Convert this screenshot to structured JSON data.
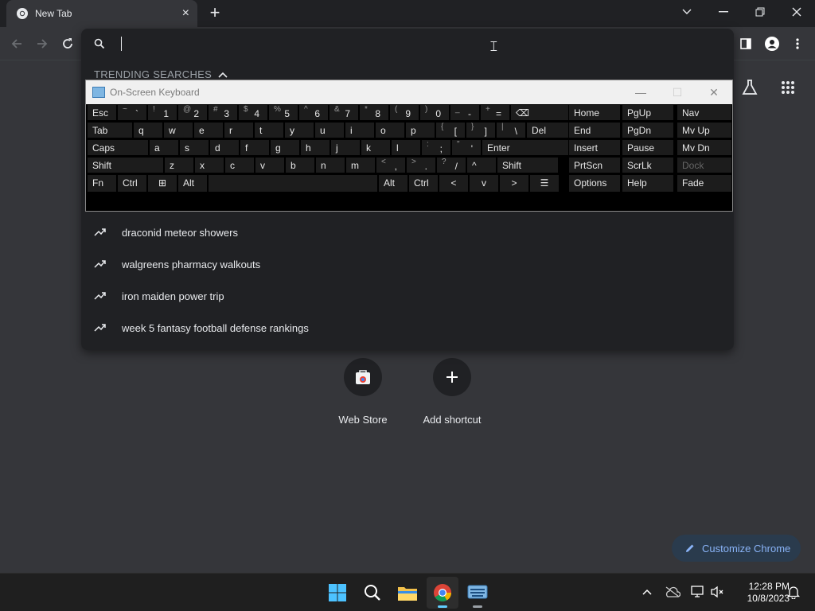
{
  "browser": {
    "tab_title": "New Tab",
    "new_tab_symbol": "+",
    "close_tab_symbol": "×"
  },
  "omnibox": {
    "trending_label": "TRENDING SEARCHES",
    "suggestions": [
      "draconid meteor showers",
      "walgreens pharmacy walkouts",
      "iron maiden power trip",
      "week 5 fantasy football defense rankings"
    ]
  },
  "shortcuts": [
    {
      "label": "Web Store"
    },
    {
      "label": "Add shortcut"
    }
  ],
  "customize_label": "Customize Chrome",
  "osk": {
    "title": "On-Screen Keyboard",
    "rows": [
      {
        "keys": [
          {
            "lbl": "Esc"
          },
          {
            "sub": "~",
            "main": "`"
          },
          {
            "sub": "!",
            "main": "1"
          },
          {
            "sub": "@",
            "main": "2"
          },
          {
            "sub": "#",
            "main": "3"
          },
          {
            "sub": "$",
            "main": "4"
          },
          {
            "sub": "%",
            "main": "5"
          },
          {
            "sub": "^",
            "main": "6"
          },
          {
            "sub": "&",
            "main": "7"
          },
          {
            "sub": "*",
            "main": "8"
          },
          {
            "sub": "(",
            "main": "9"
          },
          {
            "sub": ")",
            "main": "0"
          },
          {
            "sub": "_",
            "main": "-"
          },
          {
            "sub": "+",
            "main": "="
          },
          {
            "lbl": "⌫"
          }
        ]
      },
      {
        "keys": [
          {
            "lbl": "Tab"
          },
          {
            "lbl": "q"
          },
          {
            "lbl": "w"
          },
          {
            "lbl": "e"
          },
          {
            "lbl": "r"
          },
          {
            "lbl": "t"
          },
          {
            "lbl": "y"
          },
          {
            "lbl": "u"
          },
          {
            "lbl": "i"
          },
          {
            "lbl": "o"
          },
          {
            "lbl": "p"
          },
          {
            "sub": "{",
            "main": "["
          },
          {
            "sub": "}",
            "main": "]"
          },
          {
            "sub": "|",
            "main": "\\"
          },
          {
            "lbl": "Del"
          }
        ]
      },
      {
        "keys": [
          {
            "lbl": "Caps"
          },
          {
            "lbl": "a"
          },
          {
            "lbl": "s"
          },
          {
            "lbl": "d"
          },
          {
            "lbl": "f"
          },
          {
            "lbl": "g"
          },
          {
            "lbl": "h"
          },
          {
            "lbl": "j"
          },
          {
            "lbl": "k"
          },
          {
            "lbl": "l"
          },
          {
            "sub": ":",
            "main": ";"
          },
          {
            "sub": "\"",
            "main": "'"
          },
          {
            "lbl": "Enter"
          }
        ]
      },
      {
        "keys": [
          {
            "lbl": "Shift"
          },
          {
            "lbl": "z"
          },
          {
            "lbl": "x"
          },
          {
            "lbl": "c"
          },
          {
            "lbl": "v"
          },
          {
            "lbl": "b"
          },
          {
            "lbl": "n"
          },
          {
            "lbl": "m"
          },
          {
            "sub": "<",
            "main": ","
          },
          {
            "sub": ">",
            "main": "."
          },
          {
            "sub": "?",
            "main": "/"
          },
          {
            "lbl": "^"
          },
          {
            "lbl": "Shift"
          }
        ]
      },
      {
        "keys": [
          {
            "lbl": "Fn"
          },
          {
            "lbl": "Ctrl"
          },
          {
            "lbl": "⊞"
          },
          {
            "lbl": "Alt"
          },
          {
            "lbl": ""
          },
          {
            "lbl": "Alt"
          },
          {
            "lbl": "Ctrl"
          },
          {
            "lbl": "<"
          },
          {
            "lbl": "v"
          },
          {
            "lbl": ">"
          },
          {
            "lbl": "☰"
          }
        ]
      }
    ],
    "nav_col1": [
      "Home",
      "End",
      "Insert",
      "PrtScn",
      "Options"
    ],
    "nav_col2": [
      "PgUp",
      "PgDn",
      "Pause",
      "ScrLk",
      "Help"
    ],
    "nav_col3": [
      "Nav",
      "Mv Up",
      "Mv Dn",
      "Dock",
      "Fade"
    ]
  },
  "taskbar": {
    "time": "12:28 PM",
    "date": "10/8/2023"
  },
  "colors": {
    "page_bg": "#35363a",
    "tabstrip_bg": "#202124",
    "accent": "#8ab4f8",
    "osk_key": "#1c1c1c"
  }
}
